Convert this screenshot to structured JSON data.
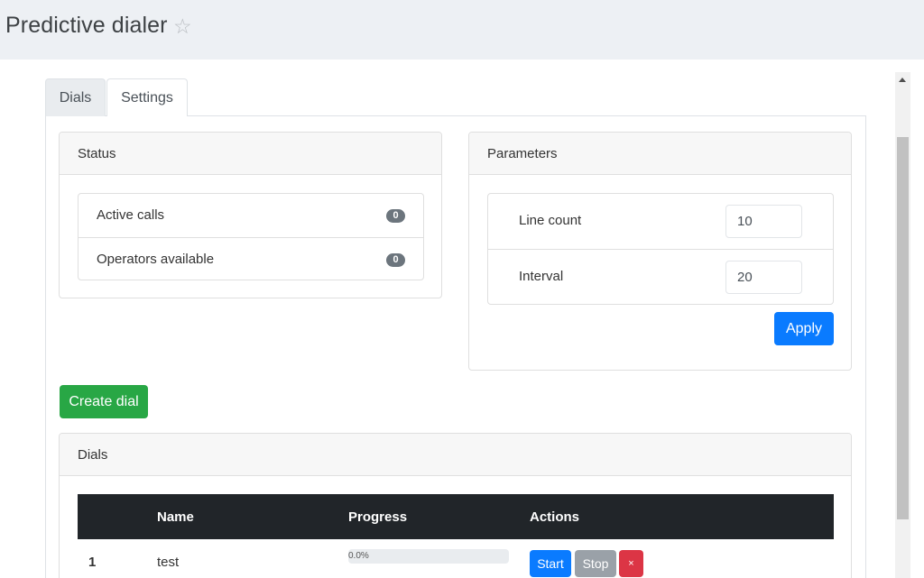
{
  "header": {
    "title": "Predictive dialer",
    "favorite_icon": "star-outline-icon"
  },
  "tabs": [
    {
      "label": "Dials",
      "active": true
    },
    {
      "label": "Settings",
      "active": false
    }
  ],
  "status": {
    "title": "Status",
    "items": [
      {
        "label": "Active calls",
        "count": "0"
      },
      {
        "label": "Operators available",
        "count": "0"
      }
    ]
  },
  "parameters": {
    "title": "Parameters",
    "fields": [
      {
        "label": "Line count",
        "value": "10"
      },
      {
        "label": "Interval",
        "value": "20"
      }
    ],
    "apply_label": "Apply"
  },
  "create_dial_label": "Create dial",
  "dials": {
    "title": "Dials",
    "columns": [
      "",
      "Name",
      "Progress",
      "Actions"
    ],
    "rows": [
      {
        "num": "1",
        "name": "test",
        "progress": 0.0,
        "progress_text": "0.0%",
        "actions": {
          "start": "Start",
          "stop": "Stop",
          "delete": "×"
        }
      }
    ]
  },
  "colors": {
    "primary": "#0a7bff",
    "success": "#28a745",
    "secondary": "#9aa1a8",
    "danger": "#dc3545",
    "table_header": "#212529"
  }
}
